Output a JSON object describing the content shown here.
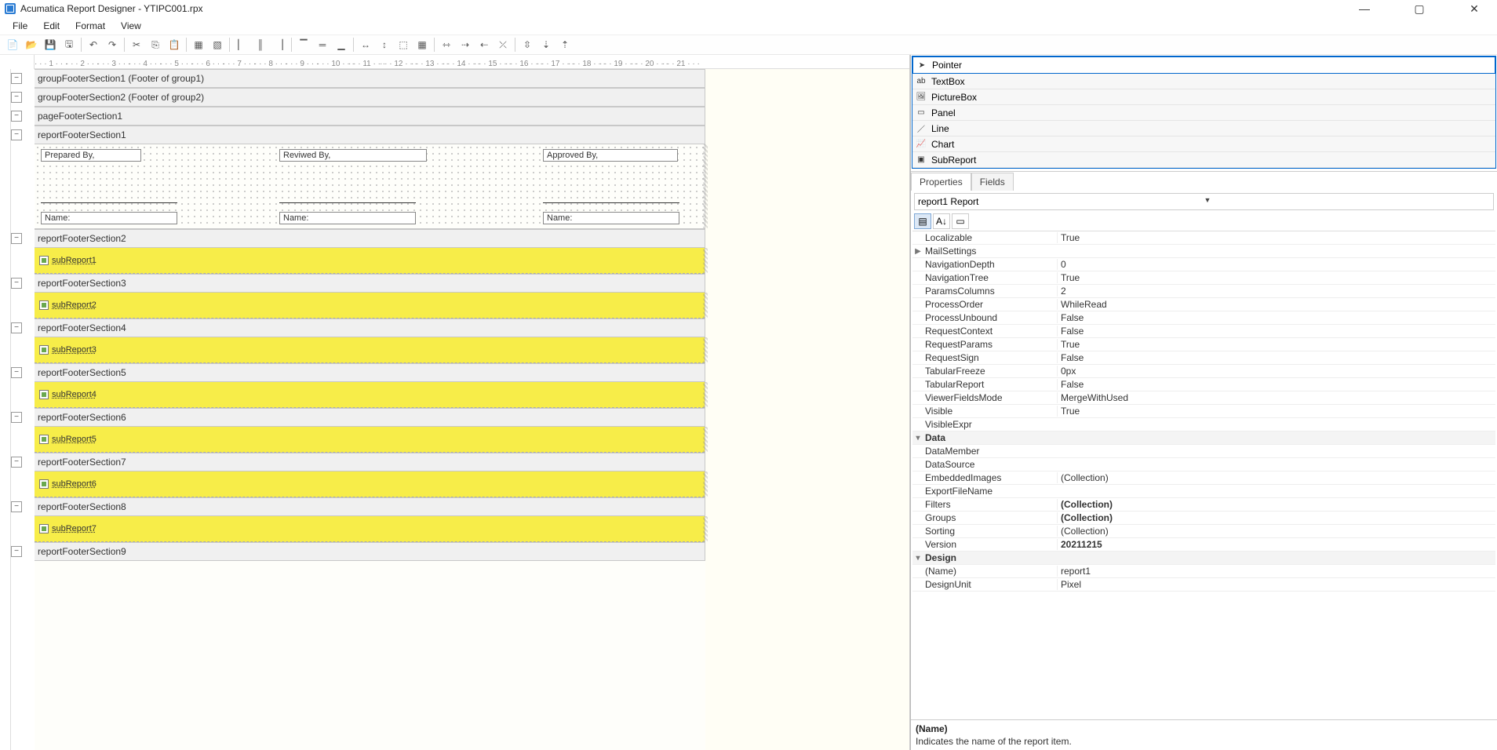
{
  "window": {
    "title": "Acumatica Report Designer - YTIPC001.rpx"
  },
  "menu": {
    "file": "File",
    "edit": "Edit",
    "format": "Format",
    "view": "View"
  },
  "ruler_marks": [
    "1",
    "2",
    "3",
    "4",
    "5",
    "6",
    "7",
    "8",
    "9",
    "10",
    "11",
    "12",
    "13",
    "14",
    "15",
    "16",
    "17",
    "18",
    "19",
    "20",
    "21"
  ],
  "sections": [
    {
      "id": "gf1",
      "label": "groupFooterSection1 (Footer of group1)",
      "collapsed": true
    },
    {
      "id": "gf2",
      "label": "groupFooterSection2 (Footer of group2)",
      "collapsed": true
    },
    {
      "id": "pf1",
      "label": "pageFooterSection1",
      "collapsed": true
    },
    {
      "id": "rf1",
      "label": "reportFooterSection1",
      "collapsed": false,
      "fields": {
        "prepared": "Prepared By,",
        "reviewed": "Reviwed By,",
        "approved": "Approved By,",
        "name1": "Name:",
        "name2": "Name:",
        "name3": "Name:"
      }
    },
    {
      "id": "rf2",
      "label": "reportFooterSection2",
      "sr": "subReport1"
    },
    {
      "id": "rf3",
      "label": "reportFooterSection3",
      "sr": "subReport2"
    },
    {
      "id": "rf4",
      "label": "reportFooterSection4",
      "sr": "subReport3"
    },
    {
      "id": "rf5",
      "label": "reportFooterSection5",
      "sr": "subReport4"
    },
    {
      "id": "rf6",
      "label": "reportFooterSection6",
      "sr": "subReport5"
    },
    {
      "id": "rf7",
      "label": "reportFooterSection7",
      "sr": "subReport6"
    },
    {
      "id": "rf8",
      "label": "reportFooterSection8",
      "sr": "subReport7"
    },
    {
      "id": "rf9",
      "label": "reportFooterSection9"
    }
  ],
  "toolbox": [
    {
      "label": "Pointer",
      "selected": true
    },
    {
      "label": "TextBox"
    },
    {
      "label": "PictureBox"
    },
    {
      "label": "Panel"
    },
    {
      "label": "Line"
    },
    {
      "label": "Chart"
    },
    {
      "label": "SubReport"
    }
  ],
  "prop_tabs": {
    "properties": "Properties",
    "fields": "Fields"
  },
  "prop_selector": "report1 Report",
  "properties": [
    {
      "name": "Localizable",
      "value": "True"
    },
    {
      "name": "MailSettings",
      "value": "",
      "expander": "▶"
    },
    {
      "name": "NavigationDepth",
      "value": "0"
    },
    {
      "name": "NavigationTree",
      "value": "True"
    },
    {
      "name": "ParamsColumns",
      "value": "2"
    },
    {
      "name": "ProcessOrder",
      "value": "WhileRead"
    },
    {
      "name": "ProcessUnbound",
      "value": "False"
    },
    {
      "name": "RequestContext",
      "value": "False"
    },
    {
      "name": "RequestParams",
      "value": "True"
    },
    {
      "name": "RequestSign",
      "value": "False"
    },
    {
      "name": "TabularFreeze",
      "value": "0px"
    },
    {
      "name": "TabularReport",
      "value": "False"
    },
    {
      "name": "ViewerFieldsMode",
      "value": "MergeWithUsed"
    },
    {
      "name": "Visible",
      "value": "True"
    },
    {
      "name": "VisibleExpr",
      "value": ""
    },
    {
      "cat": "Data",
      "expander": "▾"
    },
    {
      "name": "DataMember",
      "value": ""
    },
    {
      "name": "DataSource",
      "value": ""
    },
    {
      "name": "EmbeddedImages",
      "value": "(Collection)"
    },
    {
      "name": "ExportFileName",
      "value": ""
    },
    {
      "name": "Filters",
      "value": "(Collection)",
      "bold": true
    },
    {
      "name": "Groups",
      "value": "(Collection)",
      "bold": true
    },
    {
      "name": "Sorting",
      "value": "(Collection)"
    },
    {
      "name": "Version",
      "value": "20211215",
      "bold": true
    },
    {
      "cat": "Design",
      "expander": "▾"
    },
    {
      "name": "(Name)",
      "value": "report1"
    },
    {
      "name": "DesignUnit",
      "value": "Pixel"
    }
  ],
  "prop_help": {
    "name": "(Name)",
    "desc": "Indicates the name of the report item."
  }
}
